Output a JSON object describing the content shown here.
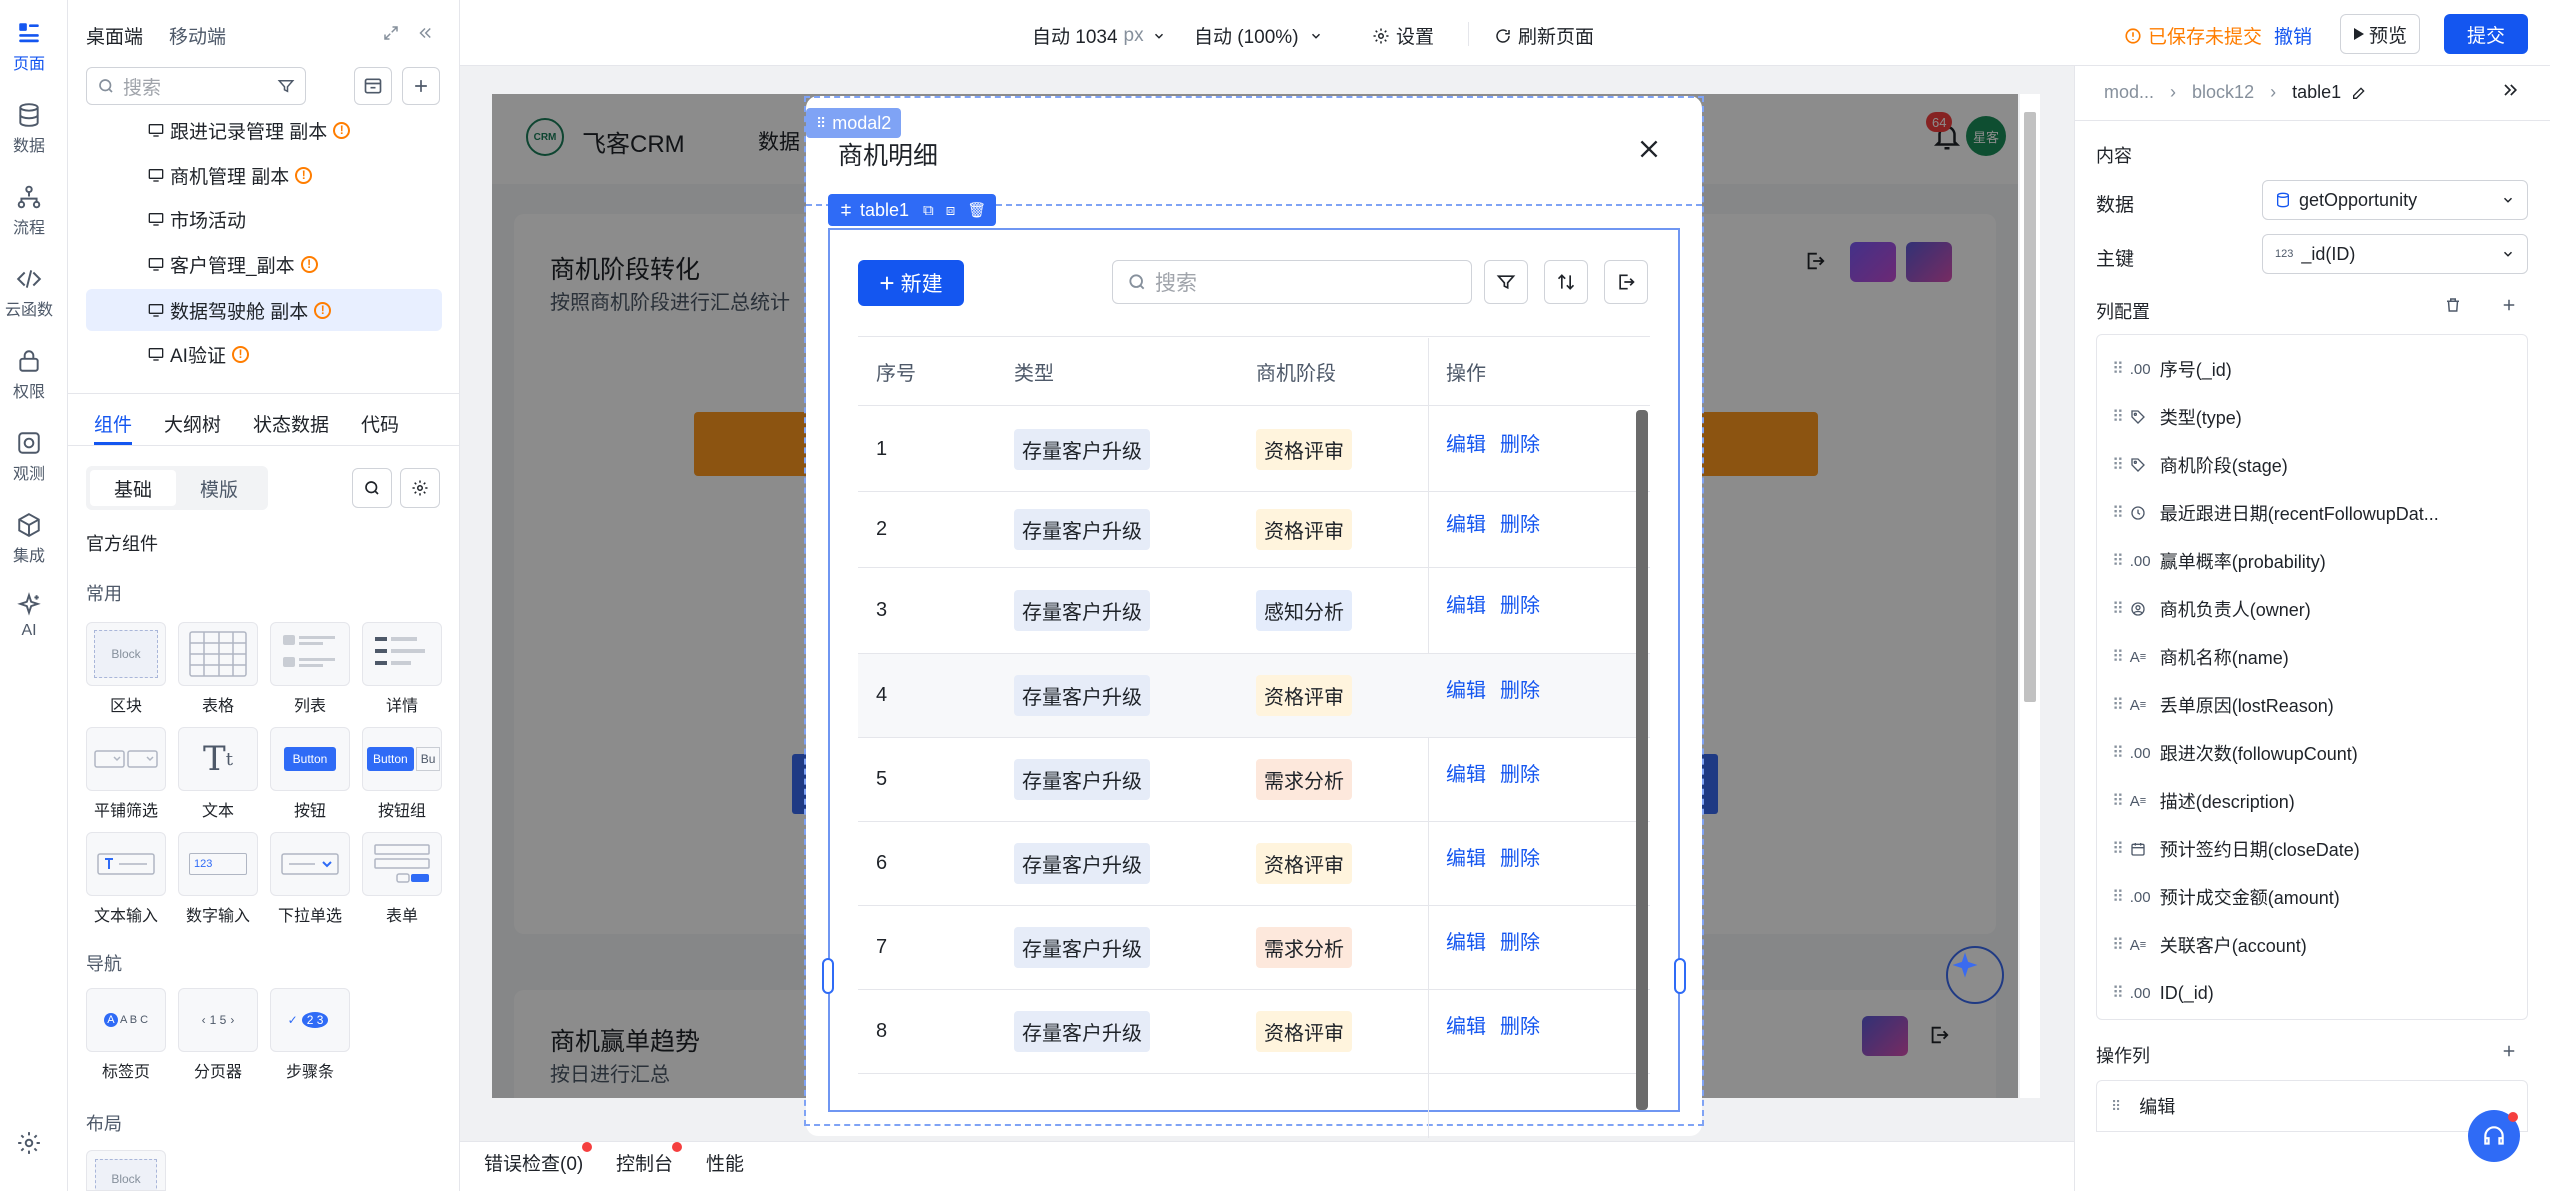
{
  "rail": {
    "items": [
      {
        "label": "页面",
        "icon": "page-icon"
      },
      {
        "label": "数据",
        "icon": "database-icon"
      },
      {
        "label": "流程",
        "icon": "flow-icon"
      },
      {
        "label": "云函数",
        "icon": "code-icon"
      },
      {
        "label": "权限",
        "icon": "lock-icon"
      },
      {
        "label": "观测",
        "icon": "monitor-icon"
      },
      {
        "label": "集成",
        "icon": "cube-icon"
      },
      {
        "label": "AI",
        "icon": "sparkle-icon"
      }
    ]
  },
  "panel": {
    "tabs_top": [
      "桌面端",
      "移动端"
    ],
    "search_placeholder": "搜索",
    "tree": [
      {
        "label": "跟进记录管理 副本",
        "warn": true
      },
      {
        "label": "商机管理 副本",
        "warn": true
      },
      {
        "label": "市场活动",
        "warn": false
      },
      {
        "label": "客户管理_副本",
        "warn": true
      },
      {
        "label": "数据驾驶舱 副本",
        "warn": true,
        "selected": true
      },
      {
        "label": "AI验证",
        "warn": true
      }
    ],
    "tabs": [
      "组件",
      "大纲树",
      "状态数据",
      "代码"
    ],
    "segment": [
      "基础",
      "模版"
    ],
    "official": "官方组件",
    "common": "常用",
    "components_common": [
      "区块",
      "表格",
      "列表",
      "详情",
      "平铺筛选",
      "文本",
      "按钮",
      "按钮组",
      "文本输入",
      "数字输入",
      "下拉单选",
      "表单"
    ],
    "nav": "导航",
    "components_nav": [
      "标签页",
      "分页器",
      "步骤条"
    ],
    "layout": "布局",
    "thumb_block": "Block",
    "thumb_button": "Button",
    "thumb_but": "Bu",
    "thumb_num": "123",
    "thumb_tabs": "A B C",
    "thumb_pager": "1 5",
    "thumb_steps": "2 3"
  },
  "topbar": {
    "width_label": "自动 1034",
    "width_unit": "px",
    "zoom_label": "自动 (100%)",
    "settings": "设置",
    "refresh": "刷新页面",
    "unsaved": "已保存未提交",
    "revoke": "撤销",
    "preview": "预览",
    "submit": "提交"
  },
  "app": {
    "logo_badge": "CRM",
    "brand": "飞客CRM",
    "nav_partial": "数据",
    "notif_count": "64",
    "avatar": "星客",
    "card1_title": "商机阶段转化",
    "card1_sub": "按照商机阶段进行汇总统计",
    "card2_title": "商机赢单趋势",
    "card2_sub": "按日进行汇总"
  },
  "modal": {
    "tag": "modal2",
    "title": "商机明细",
    "table_tag": "table1",
    "new_button": "新建",
    "search_placeholder": "搜索",
    "columns": [
      "序号",
      "类型",
      "商机阶段",
      "操作"
    ],
    "rows": [
      {
        "no": "1",
        "type": "存量客户升级",
        "stage": "资格评审",
        "stage_color": "yellow"
      },
      {
        "no": "2",
        "type": "存量客户升级",
        "stage": "资格评审",
        "stage_color": "yellow"
      },
      {
        "no": "3",
        "type": "存量客户升级",
        "stage": "感知分析",
        "stage_color": "blue"
      },
      {
        "no": "4",
        "type": "存量客户升级",
        "stage": "资格评审",
        "stage_color": "yellow"
      },
      {
        "no": "5",
        "type": "存量客户升级",
        "stage": "需求分析",
        "stage_color": "orange"
      },
      {
        "no": "6",
        "type": "存量客户升级",
        "stage": "资格评审",
        "stage_color": "yellow"
      },
      {
        "no": "7",
        "type": "存量客户升级",
        "stage": "需求分析",
        "stage_color": "orange"
      },
      {
        "no": "8",
        "type": "存量客户升级",
        "stage": "资格评审",
        "stage_color": "yellow"
      }
    ],
    "edit": "编辑",
    "delete": "删除"
  },
  "rpanel": {
    "breadcrumb": [
      "mod...",
      "block12",
      "table1"
    ],
    "content": "内容",
    "data_label": "数据",
    "data_value": "getOpportunity",
    "key_label": "主键",
    "key_prefix": "123",
    "key_value": "_id(ID)",
    "col_config": "列配置",
    "columns": [
      {
        "icon": ".00",
        "label": "序号(_id)"
      },
      {
        "icon": "tag",
        "label": "类型(type)"
      },
      {
        "icon": "tag",
        "label": "商机阶段(stage)"
      },
      {
        "icon": "clock",
        "label": "最近跟进日期(recentFollowupDat..."
      },
      {
        "icon": ".00",
        "label": "赢单概率(probability)"
      },
      {
        "icon": "user",
        "label": "商机负责人(owner)"
      },
      {
        "icon": "text",
        "label": "商机名称(name)"
      },
      {
        "icon": "text",
        "label": "丢单原因(lostReason)"
      },
      {
        "icon": ".00",
        "label": "跟进次数(followupCount)"
      },
      {
        "icon": "text",
        "label": "描述(description)"
      },
      {
        "icon": "cal",
        "label": "预计签约日期(closeDate)"
      },
      {
        "icon": ".00",
        "label": "预计成交金额(amount)"
      },
      {
        "icon": "text",
        "label": "关联客户(account)"
      },
      {
        "icon": ".00",
        "label": "ID(_id)"
      }
    ],
    "op_col": "操作列",
    "op_item": "编辑"
  },
  "bottom": {
    "errors": "错误检查(0)",
    "console": "控制台",
    "perf": "性能"
  },
  "colors": {
    "primary": "#1456f0",
    "warning": "#ff7d00",
    "danger": "#f53f3f"
  }
}
